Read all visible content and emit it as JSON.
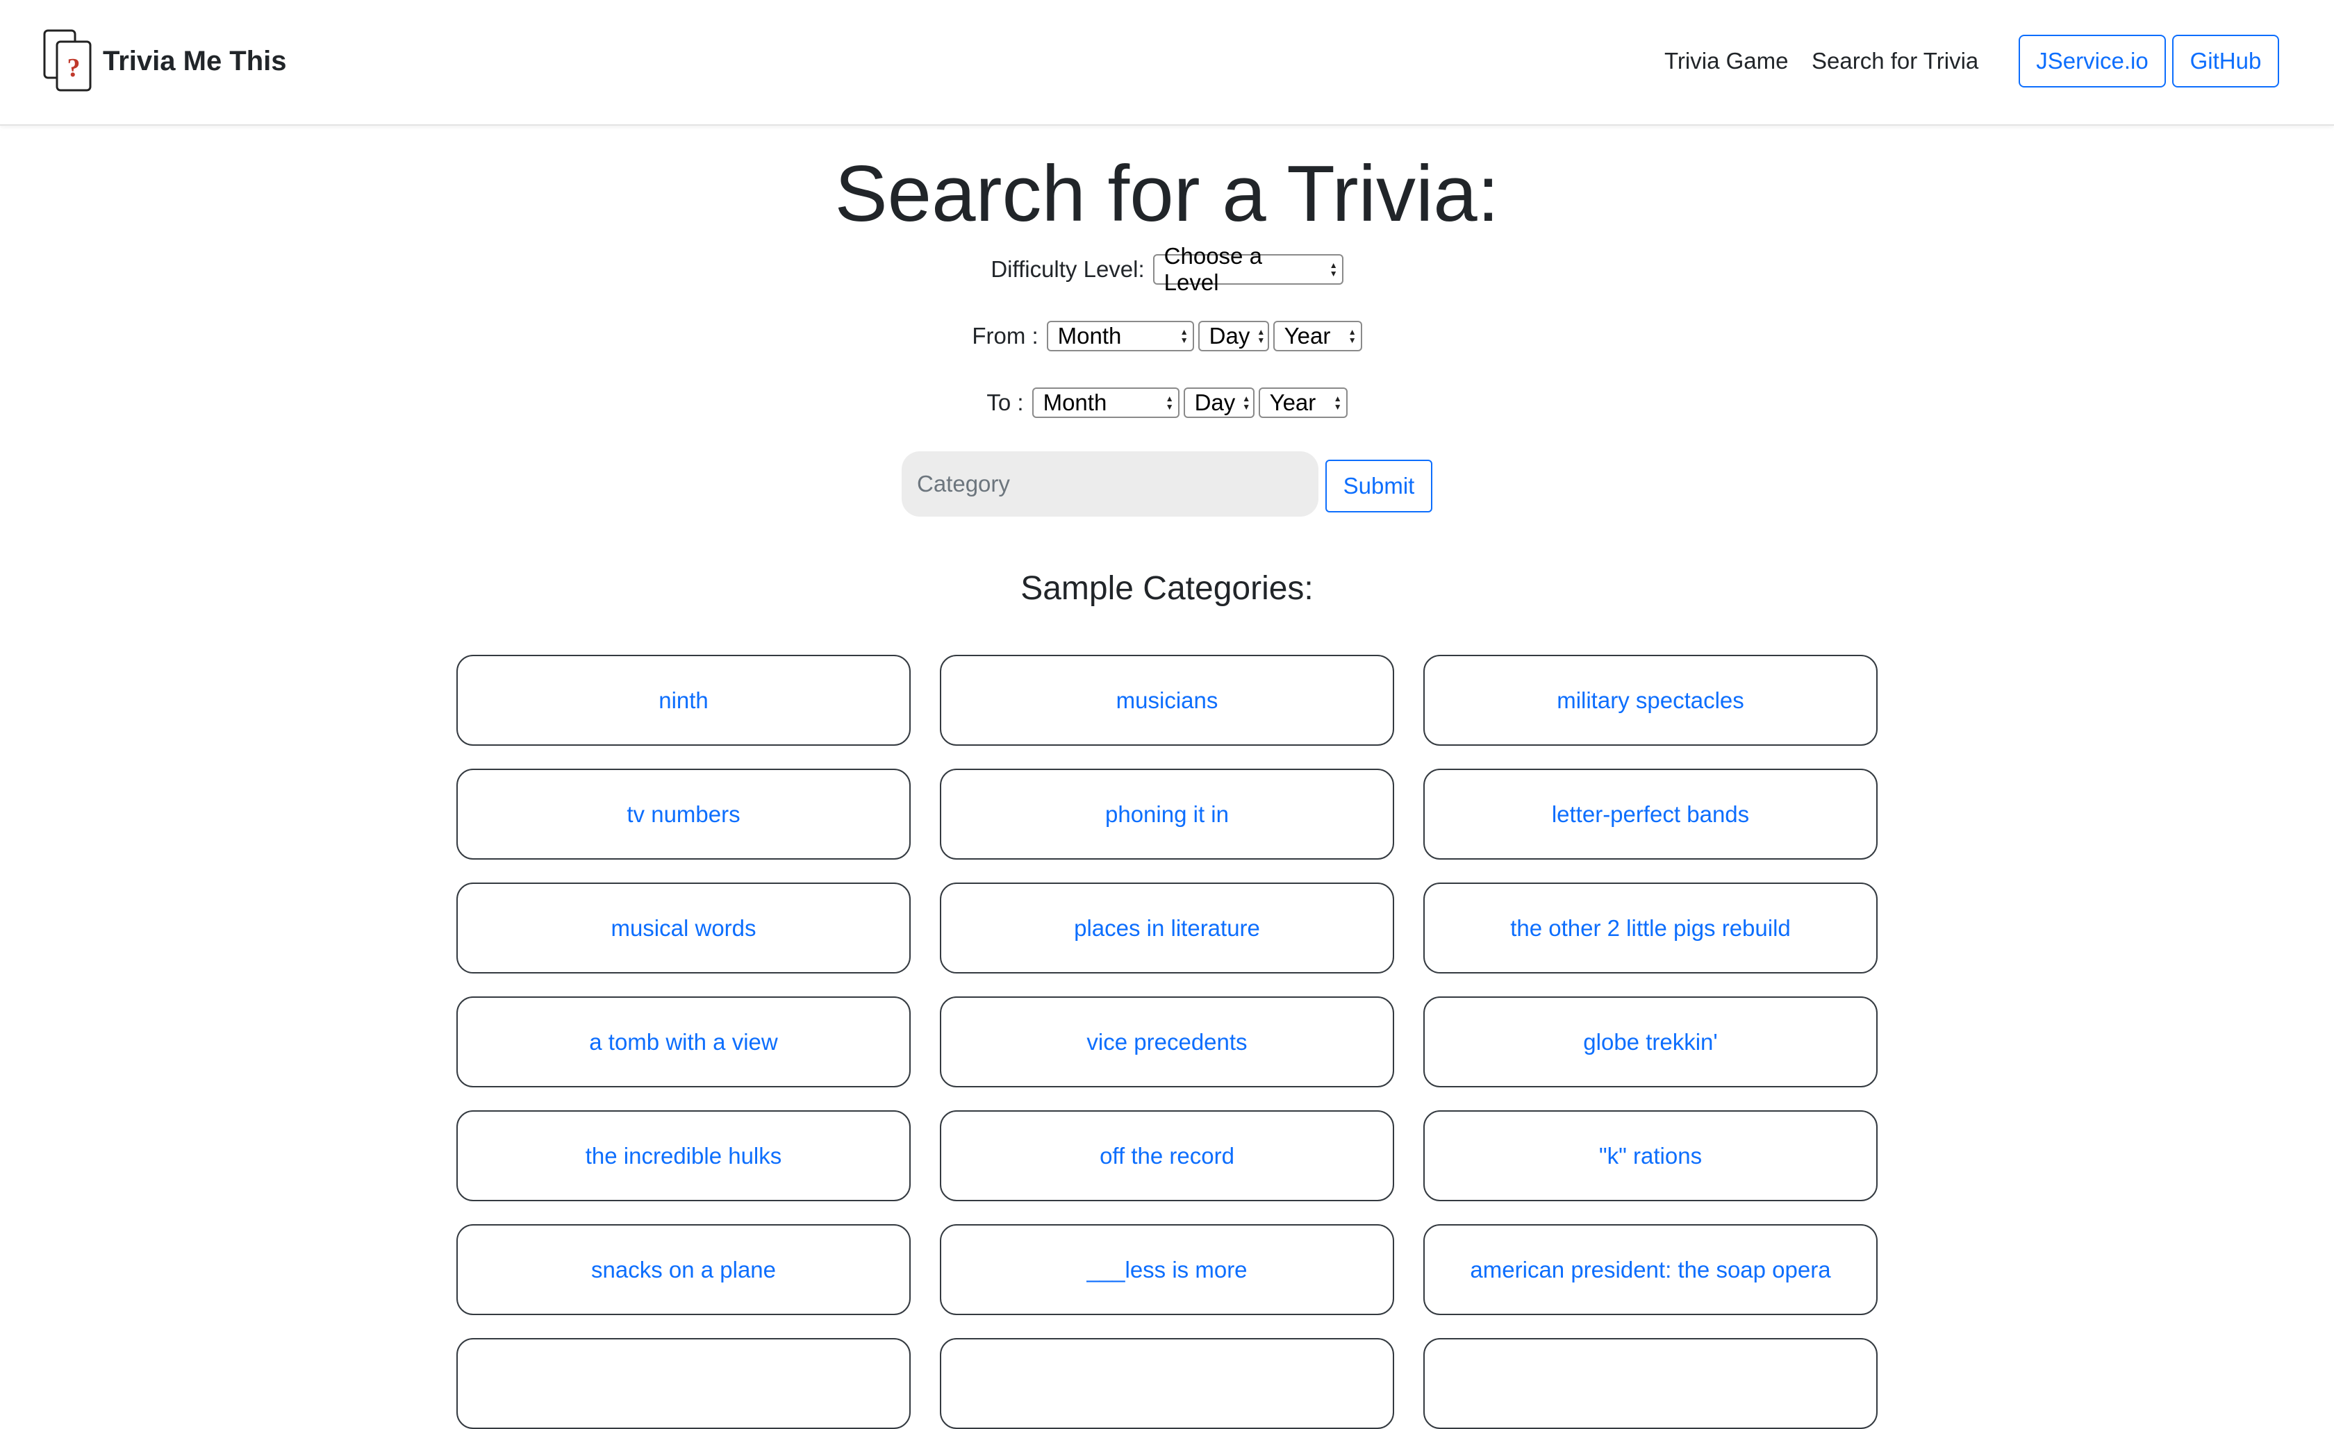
{
  "navbar": {
    "brand": "Trivia Me This",
    "links": [
      "Trivia Game",
      "Search for Trivia"
    ],
    "buttons": [
      "JService.io",
      "GitHub"
    ]
  },
  "main": {
    "title": "Search for a Trivia:",
    "difficulty_label": "Difficulty Level:",
    "difficulty_value": "Choose a Level",
    "from_label": "From :",
    "to_label": "To :",
    "month": "Month",
    "day": "Day",
    "year": "Year",
    "category_placeholder": "Category",
    "submit": "Submit",
    "sample_title": "Sample Categories:",
    "categories": [
      "ninth",
      "musicians",
      "military spectacles",
      "tv numbers",
      "phoning it in",
      "letter-perfect bands",
      "musical words",
      "places in literature",
      "the other 2 little pigs rebuild",
      "a tomb with a view",
      "vice precedents",
      "globe trekkin'",
      "the incredible hulks",
      "off the record",
      "\"k\" rations",
      "snacks on a plane",
      "___less is more",
      "american president: the soap opera",
      "",
      "",
      ""
    ]
  },
  "colors": {
    "accent": "#0d6efd",
    "text": "#212529",
    "input_bg": "#ececec"
  }
}
